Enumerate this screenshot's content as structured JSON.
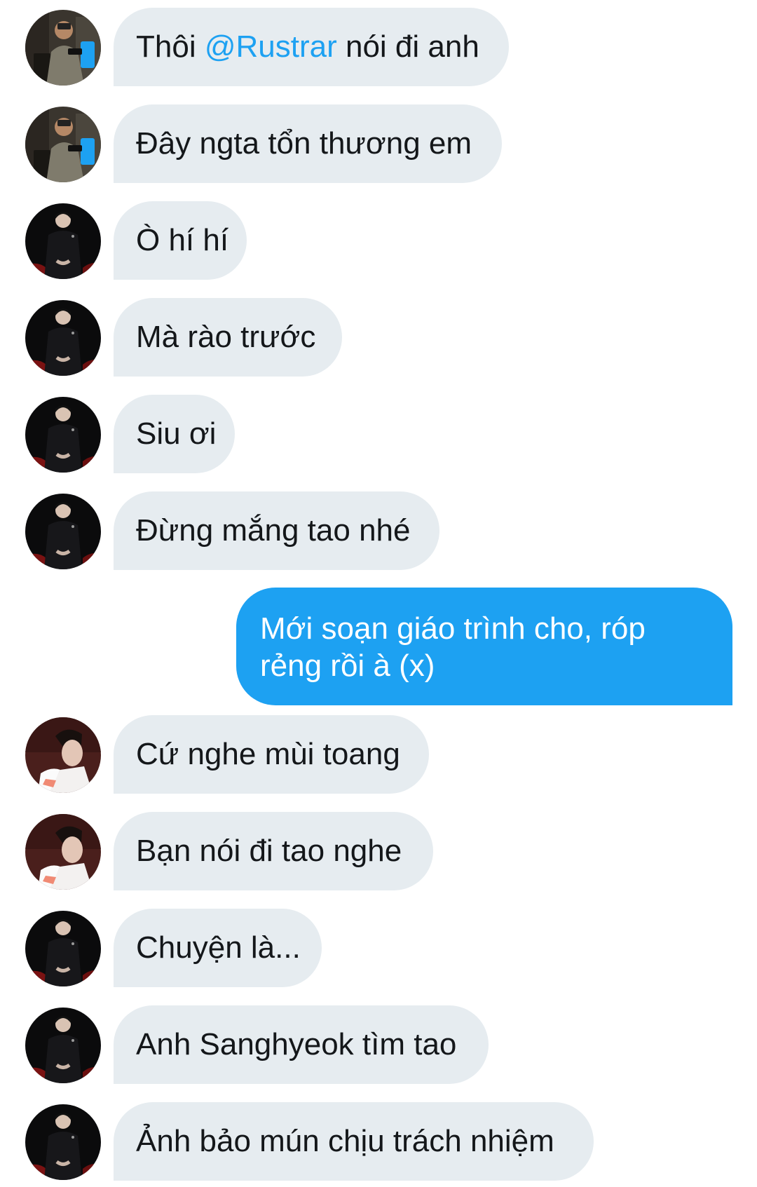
{
  "messages": [
    {
      "id": "m1",
      "avatar": "gym-man-avatar",
      "text_before": "Thôi ",
      "mention": "@Rustrar",
      "text_after": " nói đi anh"
    },
    {
      "id": "m2",
      "avatar": "gym-man-avatar",
      "text": "Đây ngta tổn thương em"
    },
    {
      "id": "m3",
      "avatar": "dark-jacket-avatar",
      "text": "Ò hí hí"
    },
    {
      "id": "m4",
      "avatar": "dark-jacket-avatar",
      "text": "Mà rào trước"
    },
    {
      "id": "m5",
      "avatar": "dark-jacket-avatar",
      "text": "Siu ơi"
    },
    {
      "id": "m6",
      "avatar": "dark-jacket-avatar",
      "text": "Đừng mắng tao nhé"
    },
    {
      "id": "m7",
      "outgoing": true,
      "text": "Mới soạn giáo trình cho, róp rẻng rồi à (x)"
    },
    {
      "id": "m8",
      "avatar": "white-jacket-avatar",
      "text": "Cứ nghe mùi toang"
    },
    {
      "id": "m9",
      "avatar": "white-jacket-avatar",
      "text": "Bạn nói đi tao nghe"
    },
    {
      "id": "m10",
      "avatar": "dark-jacket-avatar",
      "text": "Chuyện là..."
    },
    {
      "id": "m11",
      "avatar": "dark-jacket-avatar",
      "text": "Anh Sanghyeok tìm tao"
    },
    {
      "id": "m12",
      "avatar": "dark-jacket-avatar",
      "text": "Ảnh bảo mún chịu trách nhiệm"
    }
  ],
  "colors": {
    "incoming_bubble": "#e6ecf0",
    "outgoing_bubble": "#1da1f2",
    "mention": "#1da1f2",
    "text": "#14171a",
    "background": "#ffffff"
  }
}
